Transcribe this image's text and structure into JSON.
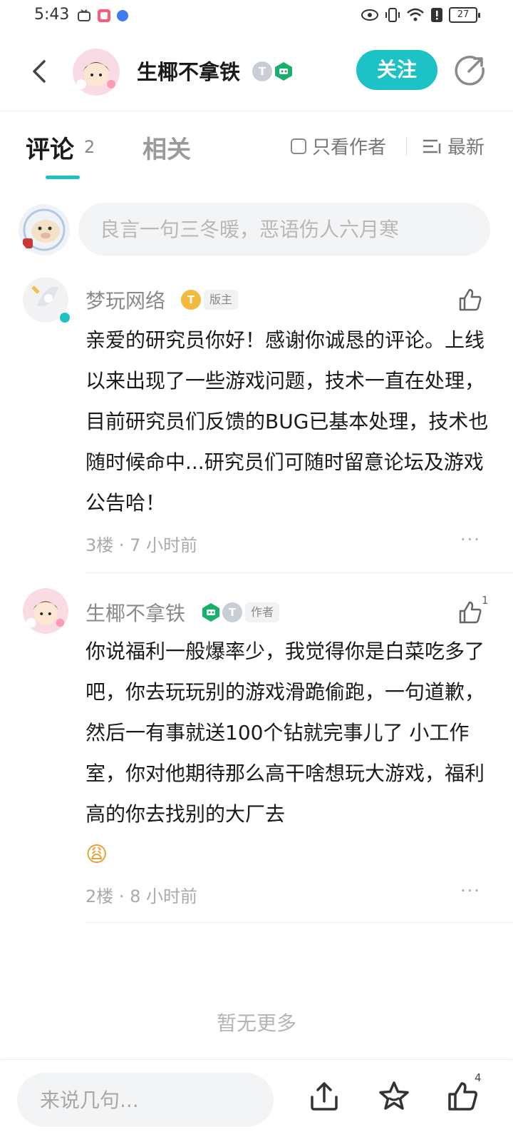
{
  "status_bar": {
    "time": "5:43",
    "battery": "27"
  },
  "header": {
    "username": "生椰不拿铁",
    "badge_t": "T",
    "follow_label": "关注"
  },
  "tabs": {
    "comments_label": "评论",
    "comments_count": "2",
    "related_label": "相关",
    "only_author_label": "只看作者",
    "sort_label": "最新"
  },
  "comment_input": {
    "placeholder": "良言一句三冬暖，恶语伤人六月寒"
  },
  "comments": [
    {
      "name": "梦玩网络",
      "level_badge": "T",
      "role": "版主",
      "likes": "",
      "body": "亲爱的研究员你好！感谢你诚恳的评论。上线以来出现了一些游戏问题，技术一直在处理，目前研究员们反馈的BUG已基本处理，技术也随时候命中...研究员们可随时留意论坛及游戏公告哈！",
      "meta": "3楼 · 7 小时前",
      "more": "···"
    },
    {
      "name": "生椰不拿铁",
      "level_badge": "T",
      "role": "作者",
      "likes": "1",
      "body": "你说福利一般爆率少，我觉得你是白菜吃多了吧，你去玩玩别的游戏滑跪偷跑，一句道歉，然后一有事就送100个钻就完事儿了 小工作室，你对他期待那么高干啥想玩大游戏，福利高的你去找别的大厂去",
      "emoji": "😩",
      "meta": "2楼 · 8 小时前",
      "more": "···"
    }
  ],
  "no_more_label": "暂无更多",
  "bottom_bar": {
    "reply_placeholder": "来说几句...",
    "like_count": "4",
    "icons": [
      "share-icon",
      "star-icon",
      "thumbs-up-icon"
    ]
  },
  "colors": {
    "accent": "#1dc2c6",
    "text": "#1a1a1a",
    "muted": "#8a8a8a"
  }
}
